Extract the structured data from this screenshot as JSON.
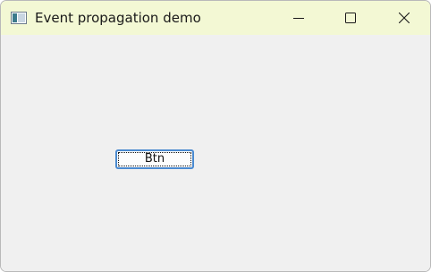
{
  "window": {
    "title": "Event propagation demo",
    "app_icon": "window-app-icon",
    "caption_buttons": {
      "minimize_icon": "minimize-icon",
      "maximize_icon": "maximize-icon",
      "close_icon": "close-icon"
    }
  },
  "client": {
    "button_label": "Btn"
  },
  "colors": {
    "titlebar_bg": "#f3f8d4",
    "client_bg": "#f0f0f0",
    "focus_border": "#4a8ad0"
  }
}
